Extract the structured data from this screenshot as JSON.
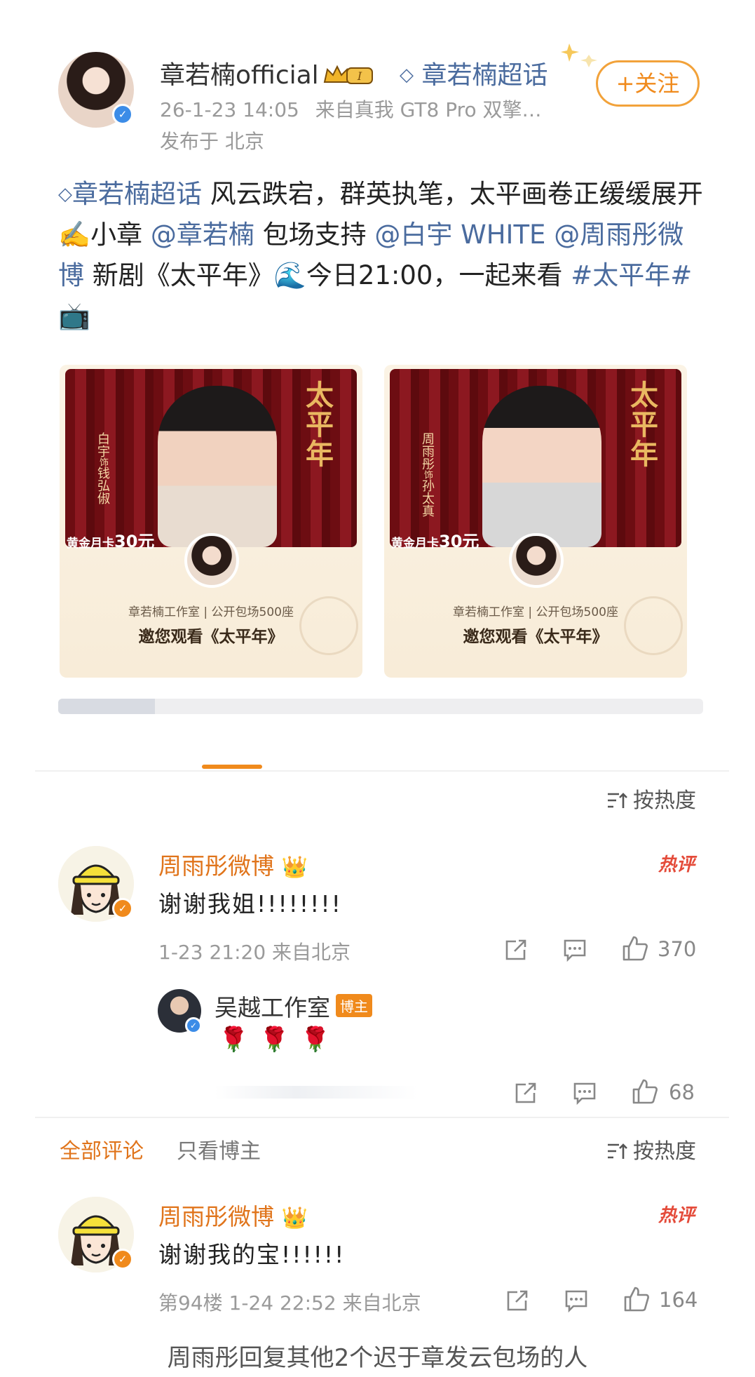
{
  "post": {
    "author": "章若楠official",
    "author_level_badge": "I",
    "supertopic_label": "章若楠超话",
    "timestamp": "26-1-23 14:05",
    "source": "来自真我 GT8 Pro 双擎…",
    "location": "发布于 北京",
    "follow_label": "+关注",
    "body": {
      "topic": "章若楠超话",
      "t1": " 风云跌宕，群英执笔，太平画卷正缓缓展开✍️小章 ",
      "mention1": "@章若楠",
      "t2": " 包场支持 ",
      "mention2": "@白宇 WHITE",
      "t3": " ",
      "mention3": "@周雨彤微博",
      "t4": " 新剧《太平年》🌊今日21:00，一起来看 ",
      "hashtag": "#太平年#",
      "t5": " 📺"
    },
    "images": [
      {
        "title": "太平年",
        "cast_a": "白宇",
        "role_mark": "饰",
        "cast_b": "钱弘俶",
        "price_prefix": "黄金月卡",
        "price": "30元",
        "studio": "章若楠工作室 | 公开包场500座",
        "invite": "邀您观看《太平年》"
      },
      {
        "title": "太平年",
        "cast_a": "周雨彤",
        "role_mark": "饰",
        "cast_b": "孙太真",
        "price_prefix": "黄金月卡",
        "price": "30元",
        "studio": "章若楠工作室 | 公开包场500座",
        "invite": "邀您观看《太平年》"
      }
    ]
  },
  "sort_label": "按热度",
  "comments": [
    {
      "name": "周雨彤微博",
      "hot_label": "热评",
      "text": "谢谢我姐!!!!!!!!",
      "meta": "1-23 21:20 来自北京",
      "likes": "370"
    }
  ],
  "reply": {
    "name": "吴越工作室",
    "badge": "博主",
    "text": "🌹🌹🌹",
    "likes": "68"
  },
  "filter_bar": {
    "all_label": "全部评论",
    "only_blogger_label": "只看博主",
    "sort_label": "按热度"
  },
  "comment2": {
    "name": "周雨彤微博",
    "hot_label": "热评",
    "text": "谢谢我的宝!!!!!!",
    "meta": "第94楼 1-24 22:52 来自北京",
    "likes": "164"
  },
  "caption": "周雨彤回复其他2个迟于章发云包场的人",
  "colors": {
    "link_blue": "#4a6b9e",
    "accent_orange": "#f08a1c",
    "hot_red": "#e44b3a"
  }
}
